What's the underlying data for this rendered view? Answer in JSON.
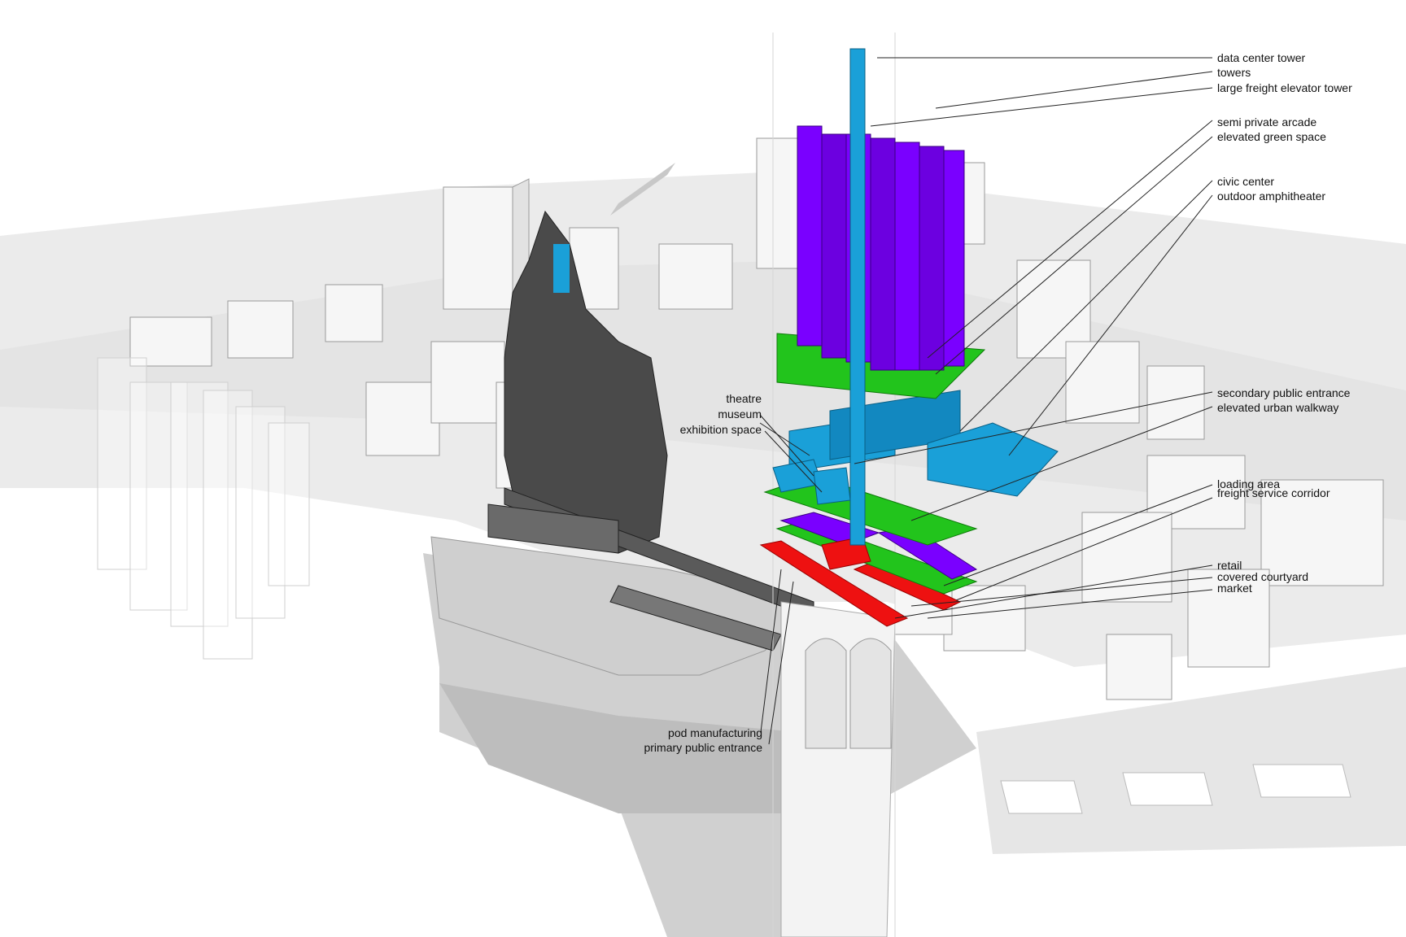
{
  "labels_right": {
    "data_center_tower": "data center tower",
    "towers": "towers",
    "large_freight_elevator_tower": "large freight elevator tower",
    "semi_private_arcade": "semi private arcade",
    "elevated_green_space": "elevated green space",
    "civic_center": "civic center",
    "outdoor_amphitheater": "outdoor amphitheater",
    "secondary_public_entrance": "secondary public entrance",
    "elevated_urban_walkway": "elevated urban walkway",
    "loading_area": "loading area",
    "freight_service_corridor": "freight service corridor",
    "retail": "retail",
    "covered_courtyard": "covered courtyard",
    "market": "market"
  },
  "labels_left": {
    "theatre": "theatre",
    "museum": "museum",
    "exhibition_space": "exhibition space"
  },
  "labels_bottom": {
    "pod_manufacturing": "pod manufacturing",
    "primary_public_entrance": "primary public entrance"
  },
  "colors": {
    "towers_purple": "#7a00ff",
    "civic_blue": "#1aa0d8",
    "green_space": "#22c41c",
    "retail_red": "#ee1111",
    "ground_gray": "#e8e8e8",
    "plaza_gray": "#bdbdbd",
    "pod_dark": "#333333"
  }
}
